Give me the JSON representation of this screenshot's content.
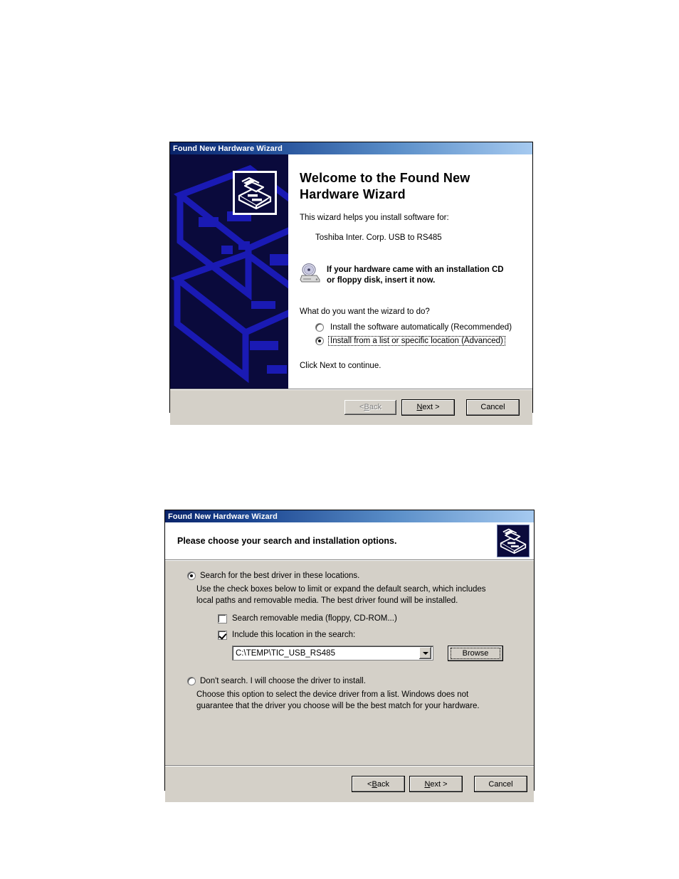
{
  "welcome_dialog": {
    "title": "Found New Hardware Wizard",
    "heading_line1": "Welcome to the Found New",
    "heading_line2": "Hardware Wizard",
    "intro": "This wizard helps you install software for:",
    "device_name": "Toshiba Inter. Corp. USB to RS485",
    "cd_note_line1": "If your hardware came with an installation CD",
    "cd_note_line2": "or floppy disk, insert it now.",
    "question": "What do you want the wizard to do?",
    "options": [
      {
        "label": "Install the software automatically (Recommended)",
        "selected": false,
        "focused": false
      },
      {
        "label": "Install from a list or specific location (Advanced)",
        "selected": true,
        "focused": true
      }
    ],
    "footer_note": "Click Next to continue.",
    "buttons": [
      {
        "label": "< Back",
        "enabled": false,
        "default": false
      },
      {
        "label": "Next >",
        "enabled": true,
        "default": true
      },
      {
        "label": "Cancel",
        "enabled": true,
        "default": false
      }
    ],
    "icons": {
      "wizard_icon": "hardware-wizard-icon",
      "cd_icon": "cd-drive-icon",
      "watermark": "isometric-computer-watermark"
    }
  },
  "options_dialog": {
    "title": "Found New Hardware Wizard",
    "header_title": "Please choose your search and installation options.",
    "header_icon": "hardware-wizard-icon",
    "search_option": {
      "label": "Search for the best driver in these locations.",
      "selected": true,
      "description": "Use the check boxes below to limit or expand the default search, which includes local paths and removable media. The best driver found will be installed."
    },
    "checkboxes": [
      {
        "label": "Search removable media (floppy, CD-ROM...)",
        "checked": false
      },
      {
        "label": "Include this location in the search:",
        "checked": true
      }
    ],
    "location_combo": {
      "value": "C:\\TEMP\\TIC_USB_RS485",
      "arrow_icon": "chevron-down-icon"
    },
    "browse_button": {
      "label": "Browse"
    },
    "dont_search_option": {
      "label": "Don't search. I will choose the driver to install.",
      "selected": false,
      "description": "Choose this option to select the device driver from a list.  Windows does not guarantee that the driver you choose will be the best match for your hardware."
    },
    "buttons": [
      {
        "label": "< Back",
        "enabled": true,
        "default": false
      },
      {
        "label": "Next >",
        "enabled": true,
        "default": false
      },
      {
        "label": "Cancel",
        "enabled": true,
        "default": false
      }
    ]
  },
  "colors": {
    "title_left": "#0a246a",
    "title_right": "#a6caf0",
    "dialog_face": "#d4d0c8",
    "watermark_bg": "#0a0a3c",
    "watermark_fg": "#1a1ab4",
    "content_bg": "#ffffff",
    "disabled_text": "#808080"
  }
}
